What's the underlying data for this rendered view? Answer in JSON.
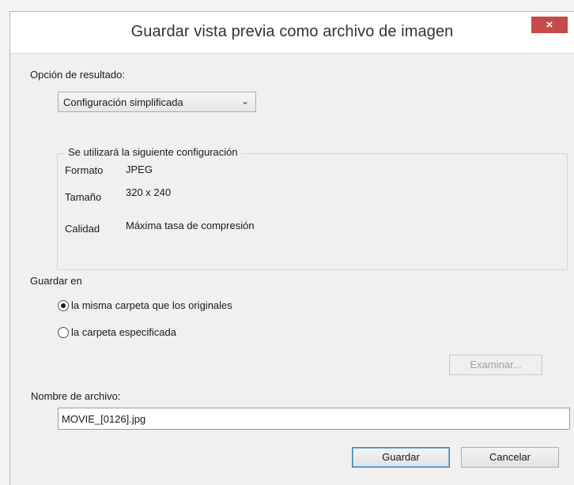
{
  "window": {
    "title": "Guardar vista previa como archivo de imagen",
    "close_glyph": "×"
  },
  "result_option": {
    "label": "Opción de resultado:",
    "selected": "Configuración simplificada"
  },
  "settings_group": {
    "legend": "Se utilizará la siguiente configuración",
    "rows": [
      {
        "label": "Formato",
        "value": "JPEG"
      },
      {
        "label": "Tamaño",
        "value": "320 x 240"
      },
      {
        "label": "Calidad",
        "value": "Máxima tasa de compresión"
      }
    ]
  },
  "save_in": {
    "label": "Guardar en",
    "options": [
      {
        "label": "la misma carpeta que los originales",
        "checked": true
      },
      {
        "label": "la carpeta especificada",
        "checked": false
      }
    ],
    "browse_label": "Examinar..."
  },
  "filename": {
    "label": "Nombre de archivo:",
    "value": "MOVIE_[0126].jpg"
  },
  "buttons": {
    "save": "Guardar",
    "cancel": "Cancelar"
  }
}
